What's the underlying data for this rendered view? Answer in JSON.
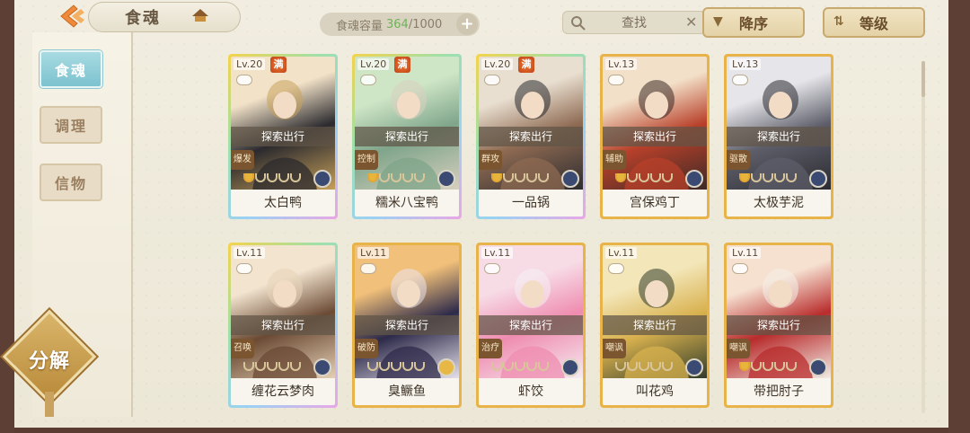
{
  "topbar": {
    "title": "食魂",
    "capacity_label": "食魂容量",
    "capacity_current": "364",
    "capacity_max": "/1000",
    "plus_label": "+",
    "search_placeholder": "查找",
    "clear_label": "✕",
    "sort_desc_label": "降序",
    "sort_level_label": "等级"
  },
  "sidebar": {
    "tabs": [
      {
        "label": "食魂",
        "active": true
      },
      {
        "label": "调理",
        "active": false
      },
      {
        "label": "信物",
        "active": false
      }
    ],
    "decompose_label": "分解"
  },
  "cards": [
    {
      "level": "Lv.20",
      "full": "满",
      "status": "探索出行",
      "role": "爆发",
      "name": "太白鸭",
      "bowls_on": 1,
      "frame": "rainbow",
      "badge": "blue"
    },
    {
      "level": "Lv.20",
      "full": "满",
      "status": "探索出行",
      "role": "控制",
      "name": "糯米八宝鸭",
      "bowls_on": 1,
      "frame": "rainbow",
      "badge": "blue"
    },
    {
      "level": "Lv.20",
      "full": "满",
      "status": "探索出行",
      "role": "群攻",
      "name": "一品锅",
      "bowls_on": 1,
      "frame": "rainbow",
      "badge": "blue"
    },
    {
      "level": "Lv.13",
      "full": "",
      "status": "探索出行",
      "role": "辅助",
      "name": "宫保鸡丁",
      "bowls_on": 1,
      "frame": "gold",
      "badge": "blue"
    },
    {
      "level": "Lv.13",
      "full": "",
      "status": "探索出行",
      "role": "驱散",
      "name": "太极芋泥",
      "bowls_on": 1,
      "frame": "gold",
      "badge": "blue"
    },
    {
      "level": "Lv.11",
      "full": "",
      "status": "探索出行",
      "role": "召唤",
      "name": "缠花云梦肉",
      "bowls_on": 0,
      "frame": "rainbow",
      "badge": "blue"
    },
    {
      "level": "Lv.11",
      "full": "",
      "status": "探索出行",
      "role": "破防",
      "name": "臭鳜鱼",
      "bowls_on": 0,
      "frame": "gold",
      "badge": "gold"
    },
    {
      "level": "Lv.11",
      "full": "",
      "status": "探索出行",
      "role": "治疗",
      "name": "虾饺",
      "bowls_on": 0,
      "frame": "gold",
      "badge": "blue"
    },
    {
      "level": "Lv.11",
      "full": "",
      "status": "探索出行",
      "role": "嘲讽",
      "name": "叫花鸡",
      "bowls_on": 0,
      "frame": "gold",
      "badge": "blue"
    },
    {
      "level": "Lv.11",
      "full": "",
      "status": "探索出行",
      "role": "嘲讽",
      "name": "带把肘子",
      "bowls_on": 1,
      "frame": "gold",
      "badge": "blue"
    }
  ],
  "colors": {
    "rainbow_frame": [
      "#f5d34a",
      "#9fe0a8",
      "#9ad2f5",
      "#e9a6e6"
    ],
    "gold_frame": "#e8b44a",
    "accent_teal": "#7cc2cf",
    "bowl_gold": "#e8b53c"
  },
  "portrait_palettes": [
    [
      "#f2e2c8",
      "#2b2a2e",
      "#c9a25b"
    ],
    [
      "#cfe6c6",
      "#7fa58a",
      "#d9d0c0"
    ],
    [
      "#e9dfd0",
      "#8e6a52",
      "#2a2a2e"
    ],
    [
      "#f3e0c8",
      "#b8402a",
      "#3a2a26"
    ],
    [
      "#e6e6ea",
      "#5e5e6a",
      "#2a2a30"
    ],
    [
      "#f2e4cf",
      "#6b4a34",
      "#e7d3b8"
    ],
    [
      "#f1c07a",
      "#2d2a4a",
      "#e9e4ee"
    ],
    [
      "#f7dce6",
      "#ef8cb0",
      "#f6eef2"
    ],
    [
      "#f3e6b8",
      "#d8b14e",
      "#2f3a2a"
    ],
    [
      "#f6e0d0",
      "#b82c2c",
      "#f4f0ea"
    ]
  ]
}
